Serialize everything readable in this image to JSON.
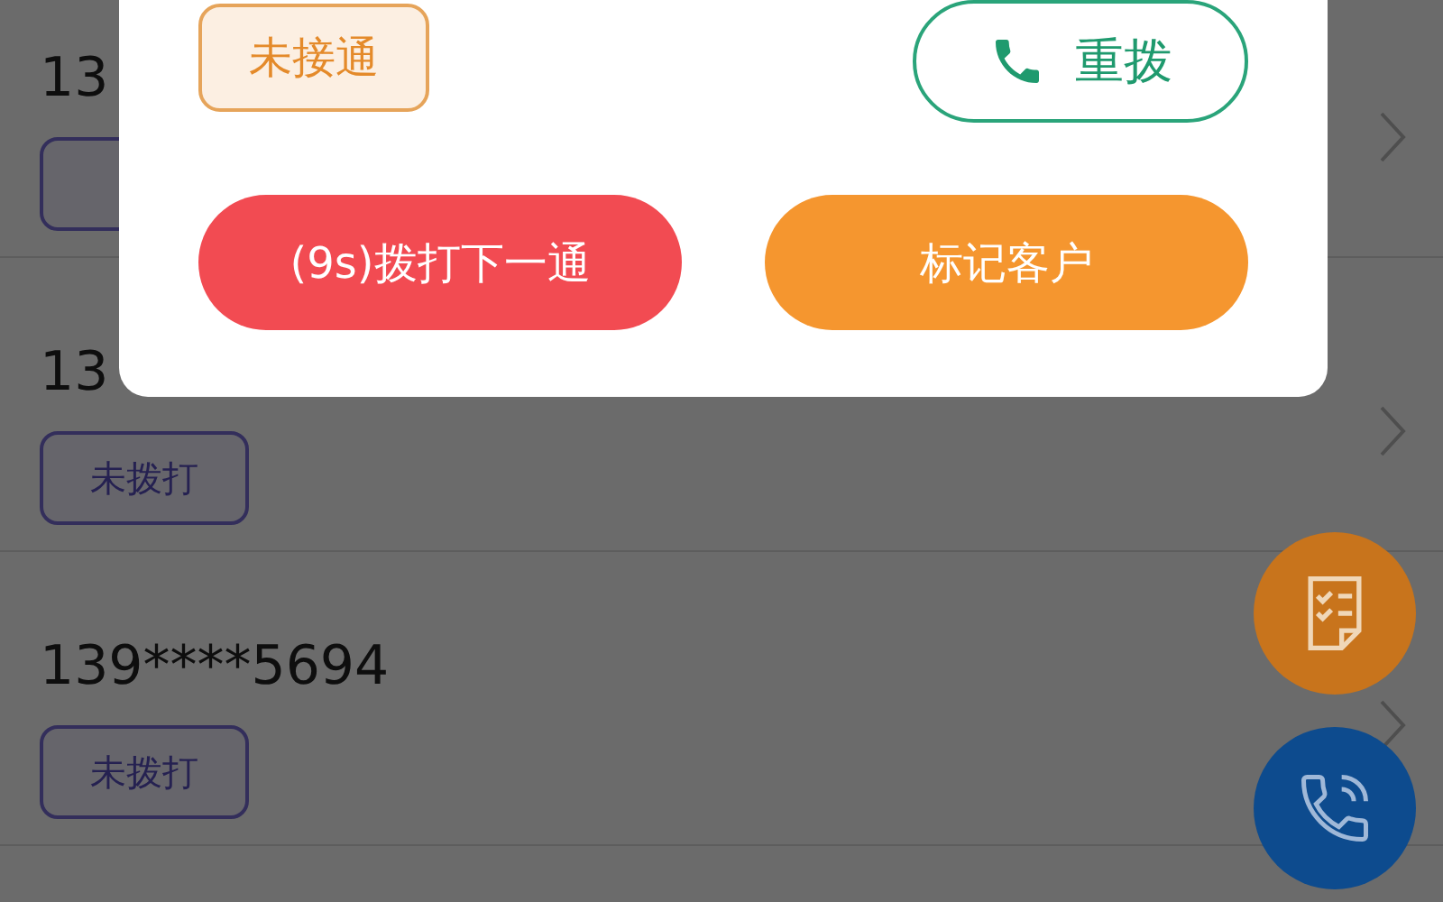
{
  "call_list": [
    {
      "number": "13",
      "has_tag": true
    },
    {
      "number": "13",
      "has_tag": true,
      "tag": "未拨打"
    },
    {
      "number": "139****5694",
      "has_tag": true,
      "tag": "未拨打"
    }
  ],
  "dialog": {
    "status_tag": "未接通",
    "redial_button": "重拨",
    "next_call_button": "(9s)拨打下一通",
    "mark_customer_button": "标记客户"
  }
}
